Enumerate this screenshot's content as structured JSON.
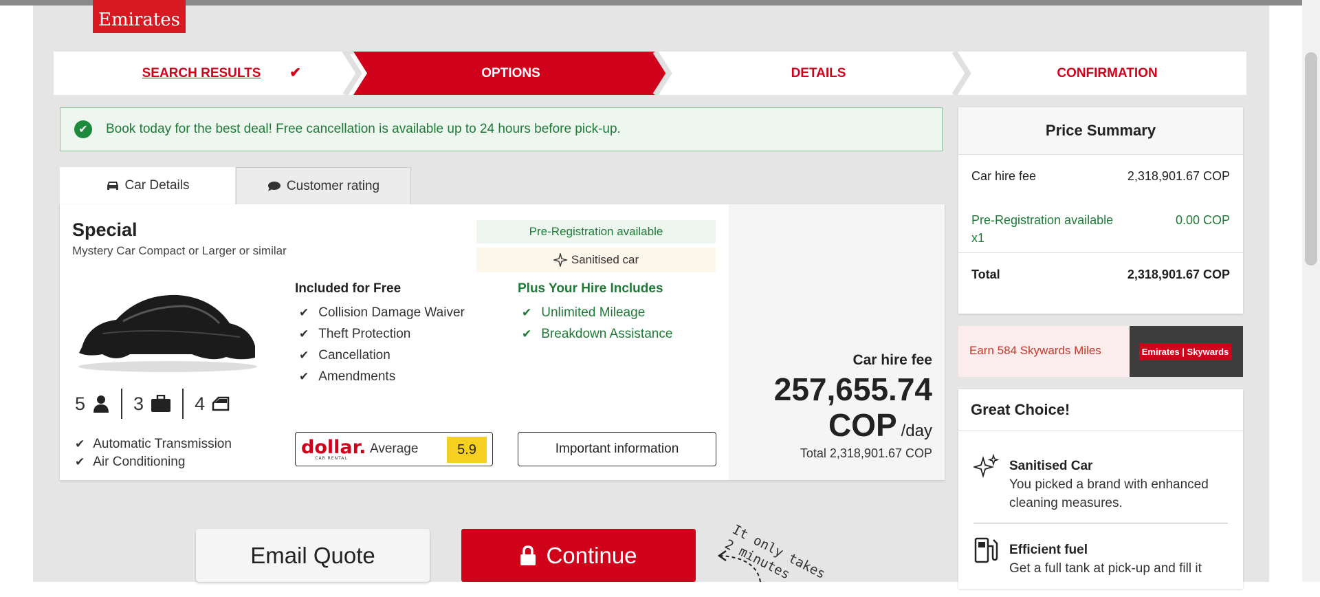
{
  "brand": {
    "logo_text": "Emirates",
    "accent": "#d0021b"
  },
  "steps": [
    {
      "label": "SEARCH RESULTS",
      "state": "completed"
    },
    {
      "label": "OPTIONS",
      "state": "active"
    },
    {
      "label": "DETAILS",
      "state": "upcoming"
    },
    {
      "label": "CONFIRMATION",
      "state": "upcoming"
    }
  ],
  "alert": {
    "text": "Book today for the best deal! Free cancellation is available up to 24 hours before pick-up."
  },
  "tabs": [
    {
      "label": "Car Details",
      "icon": "car-icon",
      "selected": true
    },
    {
      "label": "Customer rating",
      "icon": "chat-icon",
      "selected": false
    }
  ],
  "car": {
    "name": "Special",
    "subtitle": "Mystery Car Compact or Larger or similar",
    "specs": {
      "seats": "5",
      "bags": "3",
      "doors": "4"
    },
    "features": [
      "Automatic Transmission",
      "Air Conditioning"
    ],
    "badges": {
      "pre_registration": "Pre-Registration available",
      "sanitised": "Sanitised car"
    },
    "included_title": "Included for Free",
    "included": [
      "Collision Damage Waiver",
      "Theft Protection",
      "Cancellation",
      "Amendments"
    ],
    "plus_title": "Plus Your Hire Includes",
    "plus": [
      "Unlimited Mileage",
      "Breakdown Assistance"
    ],
    "supplier": {
      "logo": "dollar.",
      "logo_sub": "CAR RENTAL",
      "rating_label": "Average",
      "score": "5.9"
    },
    "important_info_label": "Important information",
    "fee_label": "Car hire fee",
    "fee_amount": "257,655.74",
    "fee_currency": "COP",
    "fee_period": "/day",
    "fee_total": "Total 2,318,901.67 COP"
  },
  "price_summary": {
    "title": "Price Summary",
    "rows": [
      {
        "label": "Car hire fee",
        "value": "2,318,901.67 COP"
      },
      {
        "label": "Pre-Registration available x1",
        "value": "0.00 COP"
      }
    ],
    "total_label": "Total",
    "total_value": "2,318,901.67 COP"
  },
  "skywards": {
    "text": "Earn 584 Skywards Miles",
    "logo": "Emirates | Skywards"
  },
  "great_choice": {
    "title": "Great Choice!",
    "items": [
      {
        "title": "Sanitised Car",
        "text": "You picked a brand with enhanced cleaning measures.",
        "icon": "sparkle-icon"
      },
      {
        "title": "Efficient fuel",
        "text": "Get a full tank at pick-up and fill it",
        "icon": "fuel-pump-icon"
      }
    ]
  },
  "actions": {
    "email_quote": "Email Quote",
    "continue": "Continue",
    "hint": "It only takes\n2 minutes"
  }
}
